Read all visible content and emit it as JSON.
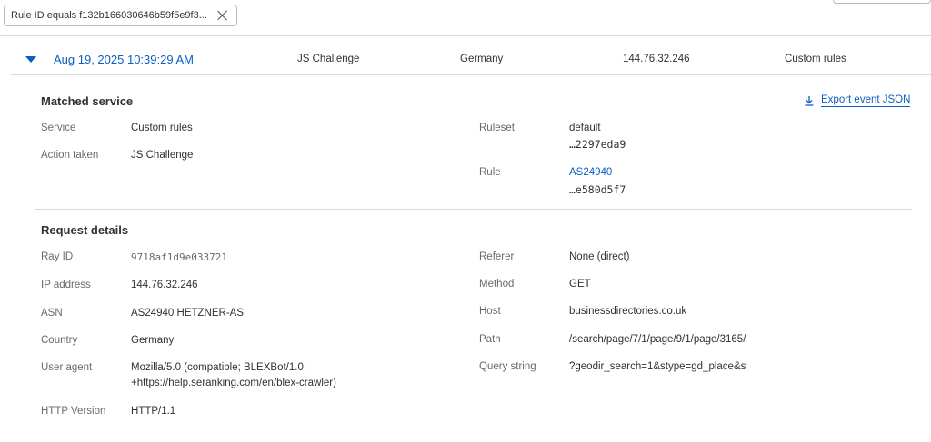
{
  "filter": {
    "chip_label": "Rule ID equals f132b166030646b59f5e9f3..."
  },
  "event": {
    "date": "Aug 19, 2025 10:39:29 AM",
    "action": "JS Challenge",
    "country": "Germany",
    "ip": "144.76.32.246",
    "service": "Custom rules"
  },
  "matched_service": {
    "title": "Matched service",
    "export_label": "Export event JSON",
    "service_label": "Service",
    "service_value": "Custom rules",
    "action_label": "Action taken",
    "action_value": "JS Challenge",
    "ruleset_label": "Ruleset",
    "ruleset_name": "default",
    "ruleset_id": "…2297eda9",
    "rule_label": "Rule",
    "rule_name": "AS24940",
    "rule_id": "…e580d5f7"
  },
  "request_details": {
    "title": "Request details",
    "ray_id_label": "Ray ID",
    "ray_id_value": "9718af1d9e033721",
    "ip_label": "IP address",
    "ip_value": "144.76.32.246",
    "asn_label": "ASN",
    "asn_value": "AS24940 HETZNER-AS",
    "country_label": "Country",
    "country_value": "Germany",
    "ua_label": "User agent",
    "ua_line1": "Mozilla/5.0 (compatible; BLEXBot/1.0;",
    "ua_line2": "+https://help.seranking.com/en/blex-crawler)",
    "http_label": "HTTP Version",
    "http_value": "HTTP/1.1",
    "referer_label": "Referer",
    "referer_value": "None (direct)",
    "method_label": "Method",
    "method_value": "GET",
    "host_label": "Host",
    "host_value": "businessdirectories.co.uk",
    "path_label": "Path",
    "path_value": "/search/page/7/1/page/9/1/page/3165/",
    "query_label": "Query string",
    "query_value": "?geodir_search=1&stype=gd_place&s"
  },
  "icons": {
    "toggle": "caret-down-icon",
    "close": "close-icon",
    "export": "download-icon"
  },
  "colors": {
    "accent": "#0b5fc4",
    "label": "#6a6a6a",
    "text": "#313131",
    "border": "#d9d9d9"
  }
}
